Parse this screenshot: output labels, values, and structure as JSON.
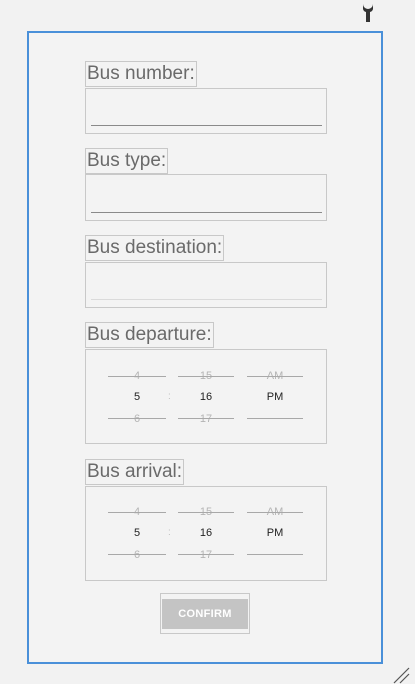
{
  "form": {
    "bus_number_label": "Bus number:",
    "bus_number_value": "",
    "bus_type_label": "Bus type:",
    "bus_type_value": "",
    "bus_destination_label": "Bus destination:",
    "bus_destination_value": "",
    "departure_label": "Bus departure:",
    "arrival_label": "Bus arrival:",
    "confirm_label": "CONFIRM"
  },
  "departure_picker": {
    "hour": {
      "prev": "4",
      "selected": "5",
      "next": "6"
    },
    "minute": {
      "prev": "15",
      "selected": "16",
      "next": "17"
    },
    "ampm": {
      "prev": "AM",
      "selected": "PM",
      "next": ""
    },
    "separator": ":"
  },
  "arrival_picker": {
    "hour": {
      "prev": "4",
      "selected": "5",
      "next": "6"
    },
    "minute": {
      "prev": "15",
      "selected": "16",
      "next": "17"
    },
    "ampm": {
      "prev": "AM",
      "selected": "PM",
      "next": ""
    },
    "separator": ":"
  },
  "icons": {
    "top_right": "wrench-icon",
    "bottom_right": "resize-handle-icon"
  },
  "colors": {
    "frame_border": "#4a90d9",
    "button_bg": "#c4c4c4"
  }
}
